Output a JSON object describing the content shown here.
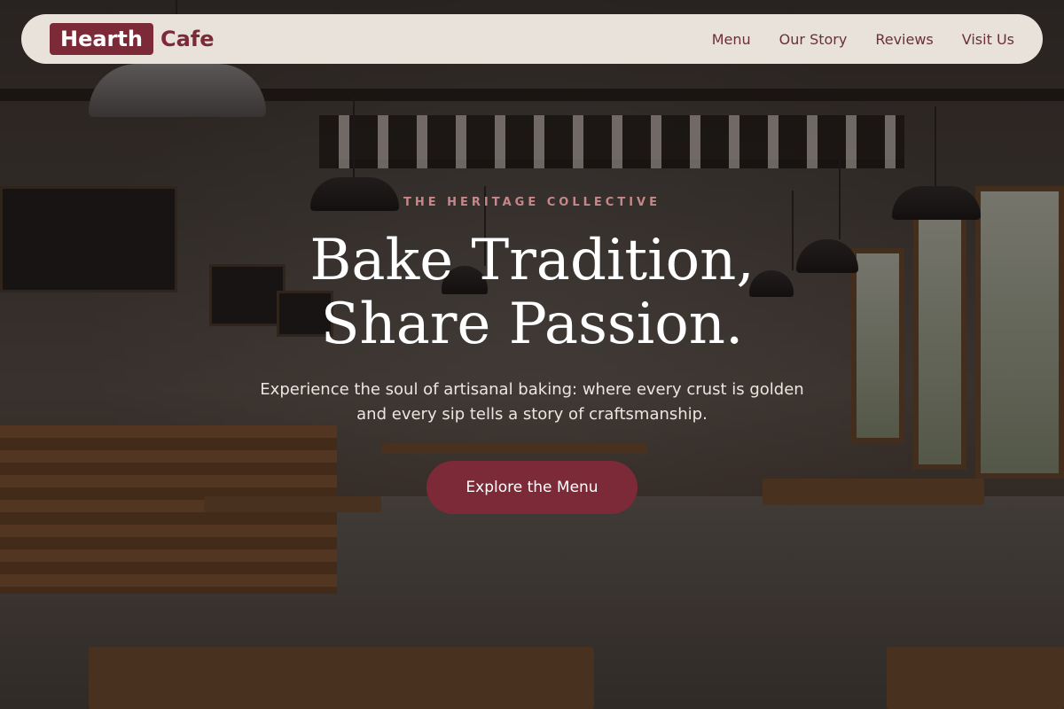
{
  "brand": {
    "badge": "Hearth",
    "rest": "Cafe"
  },
  "nav": {
    "items": [
      "Menu",
      "Our Story",
      "Reviews",
      "Visit Us"
    ]
  },
  "hero": {
    "eyebrow": "THE HERITAGE COLLECTIVE",
    "headline_line1": "Bake Tradition,",
    "headline_line2": "Share Passion.",
    "subtitle": "Experience the soul of artisanal baking: where every crust is golden and every sip tells a story of craftsmanship.",
    "cta_label": "Explore the Menu"
  },
  "colors": {
    "accent": "#7c2a37",
    "nav_bg": "#f1eae2",
    "text_light": "#ffffff"
  }
}
